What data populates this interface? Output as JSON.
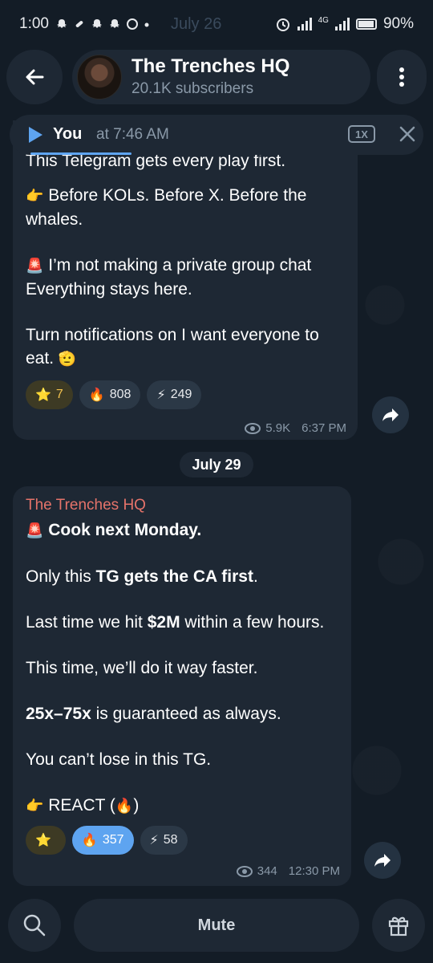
{
  "status_bar": {
    "time": "1:00",
    "date": "July 26",
    "battery": "90%",
    "network": "4G"
  },
  "header": {
    "title": "The Trenches HQ",
    "subscribers": "20.1K subscribers"
  },
  "player": {
    "name": "You",
    "time": "at 7:46 AM",
    "speed": "1X"
  },
  "message1": {
    "line_cut": "This Telegram gets every play first.",
    "p1_emoji": "👉",
    "p1": "Before KOLs. Before X. Before the whales.",
    "p2_emoji": "🚨",
    "p2": "I’m not making a private group chat Everything stays here.",
    "p3": "Turn notifications on I want everyone to eat.",
    "p3_emoji": "🫡",
    "reactions": [
      {
        "emoji": "⭐",
        "count": "7"
      },
      {
        "emoji": "🔥",
        "count": "808"
      },
      {
        "emoji": "⚡",
        "count": "249"
      }
    ],
    "views": "5.9K",
    "time": "6:37 PM"
  },
  "date_chip": "July 29",
  "message2": {
    "sender": "The Trenches HQ",
    "l1_emoji": "🚨",
    "l1": "Cook next Monday.",
    "l2_a": "Only this ",
    "l2_b": "TG gets the CA first",
    "l2_c": ".",
    "l3_a": "Last time we hit ",
    "l3_b": "$2M",
    "l3_c": " within a few hours.",
    "l4": "This time, we’ll do it way faster.",
    "l5_a": "25x–75x",
    "l5_b": " is guaranteed as always.",
    "l6": "You can’t lose in this TG.",
    "l7_emoji": "👉",
    "l7_a": " REACT (",
    "l7_fire": "🔥",
    "l7_b": ")",
    "reactions": [
      {
        "emoji": "⭐",
        "count": ""
      },
      {
        "emoji": "🔥",
        "count": "357"
      },
      {
        "emoji": "⚡",
        "count": "58"
      }
    ],
    "views": "344",
    "time": "12:30 PM"
  },
  "bottom_bar": {
    "mute_label": "Mute"
  }
}
